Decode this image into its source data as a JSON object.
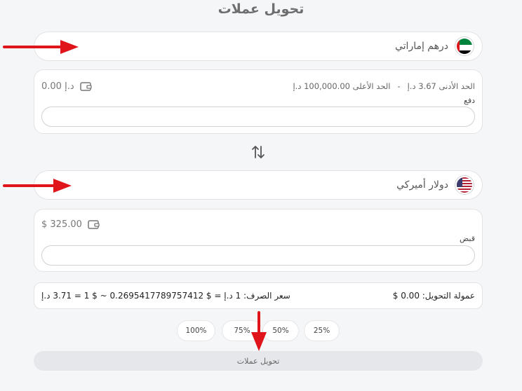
{
  "page_title": "تحويل عملات",
  "from_currency": {
    "name": "درهم إماراتي",
    "flag_icon": "uae-flag-icon"
  },
  "from_card": {
    "balance": "0.00 د.إ",
    "min_limit": "الحد الأدنى 3.67 د.إ",
    "separator": "-",
    "max_limit": "الحد الأعلى 100,000.00 د.إ",
    "field_label": "دفع",
    "input_value": ""
  },
  "swap_icon": "swap-arrows-icon",
  "to_currency": {
    "name": "دولار أميركي",
    "flag_icon": "usa-flag-icon"
  },
  "to_card": {
    "balance": "$ 325.00",
    "field_label": "قبض",
    "input_value": ""
  },
  "info": {
    "fee": "عمولة التحويل: 0.00 $",
    "rate": "سعر الصرف: 1 د.إ = $ 0.2695417789757412 ~ $ 1 = 3.71 د.إ"
  },
  "percent_buttons": [
    "100%",
    "75%",
    "50%",
    "25%"
  ],
  "convert_button": "تحويل عملات",
  "colors": {
    "background": "#f5f6f8",
    "annotation_arrow": "#e0141b"
  }
}
